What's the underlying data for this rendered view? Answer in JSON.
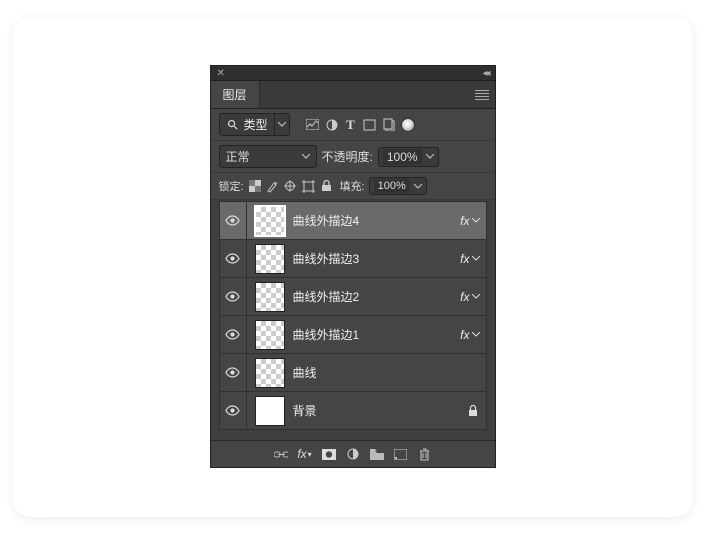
{
  "panel": {
    "title": "图层",
    "filter": {
      "label": "类型"
    },
    "blend": {
      "mode": "正常",
      "opacityLabel": "不透明度:",
      "opacity": "100%"
    },
    "lock": {
      "label": "锁定:",
      "fillLabel": "填充:",
      "fill": "100%"
    }
  },
  "layers": [
    {
      "name": "曲线外描边4",
      "fx": true,
      "selected": true,
      "checker": true
    },
    {
      "name": "曲线外描边3",
      "fx": true,
      "selected": false,
      "checker": true
    },
    {
      "name": "曲线外描边2",
      "fx": true,
      "selected": false,
      "checker": true
    },
    {
      "name": "曲线外描边1",
      "fx": true,
      "selected": false,
      "checker": true
    },
    {
      "name": "曲线",
      "fx": false,
      "selected": false,
      "checker": true
    },
    {
      "name": "背景",
      "fx": false,
      "selected": false,
      "checker": false,
      "locked": true
    }
  ]
}
